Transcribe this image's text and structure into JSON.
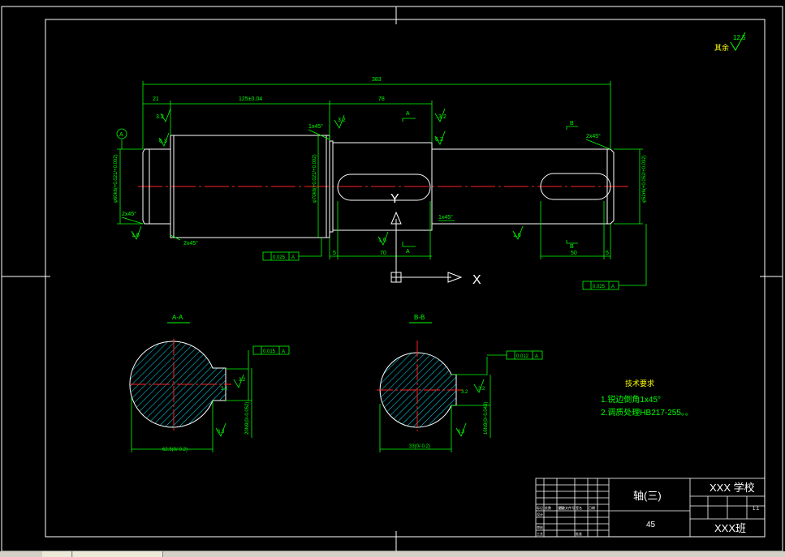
{
  "colors": {
    "background": "#000000",
    "outline": "#ffffff",
    "dimension": "#00ff00",
    "centerline": "#ff2020",
    "hatch": "#00e5ff",
    "text_yellow": "#ffff00"
  },
  "roughness_corner": {
    "label": "其余",
    "value": "12.5"
  },
  "main_view": {
    "overall_length": "383",
    "dim_left_shoulder": "21",
    "dim_main_section": "125±0.04",
    "dim_middle_section": "78",
    "dim_key1_length": "70",
    "dim_key2_length": "50",
    "dim_offset_left": "5",
    "dim_offset_right": "5",
    "chamfer_a": "1x45°",
    "chamfer_b": "1x45°",
    "chamfer_c": "2x45°",
    "chamfer_d": "2x45°",
    "chamfer_e": "2x45°",
    "rough_1": "3.2",
    "rough_2": "3.2",
    "rough_3": "3.2",
    "rough_4": "1.6",
    "rough_5": "1.6",
    "rough_6": "1.6",
    "rough_7": "6.3",
    "rough_8": "6.3",
    "datum_label": "A",
    "section_a_label": "A",
    "section_b_label": "B",
    "diam_left": "φ60k6(+0.021/+0.002)",
    "diam_mid": "φ70k6(+0.021/+0.002)",
    "diam_right": "φ52r6(+0.052/+0.032)",
    "tol_left": "0.025",
    "tol_right": "0.025",
    "tol_datum": "A"
  },
  "axis_labels": {
    "x": "X",
    "y": "Y"
  },
  "section_aa": {
    "title": "A-A",
    "tol": "0.015",
    "tol_datum": "A",
    "rough_side": "3.2",
    "rough_bottom": "6.3",
    "width_dim": "20N9(0/-0.052)",
    "depth_dim": "62.5(0/-0.2)"
  },
  "section_bb": {
    "title": "B-B",
    "tol": "0.012",
    "tol_datum": "A",
    "rough_side": "3.2",
    "rough_bottom": "6.3",
    "width_dim": "16N9(0/-0.043)",
    "depth_dim": "33(0/-0.2)"
  },
  "tech_req": {
    "title": "技术要求",
    "line1": "1.锐边倒角1x45°",
    "line2": "2.调质处理HB217-255。。"
  },
  "title_block": {
    "part_name": "轴(三)",
    "material": "45",
    "school": "XXX 学校",
    "class_name": "XXX班",
    "scale": "1:1",
    "small_labels": [
      "标记",
      "处数",
      "分区",
      "更改文件号",
      "签名",
      "日期",
      "设计",
      "审核",
      "工艺",
      "批准"
    ]
  }
}
